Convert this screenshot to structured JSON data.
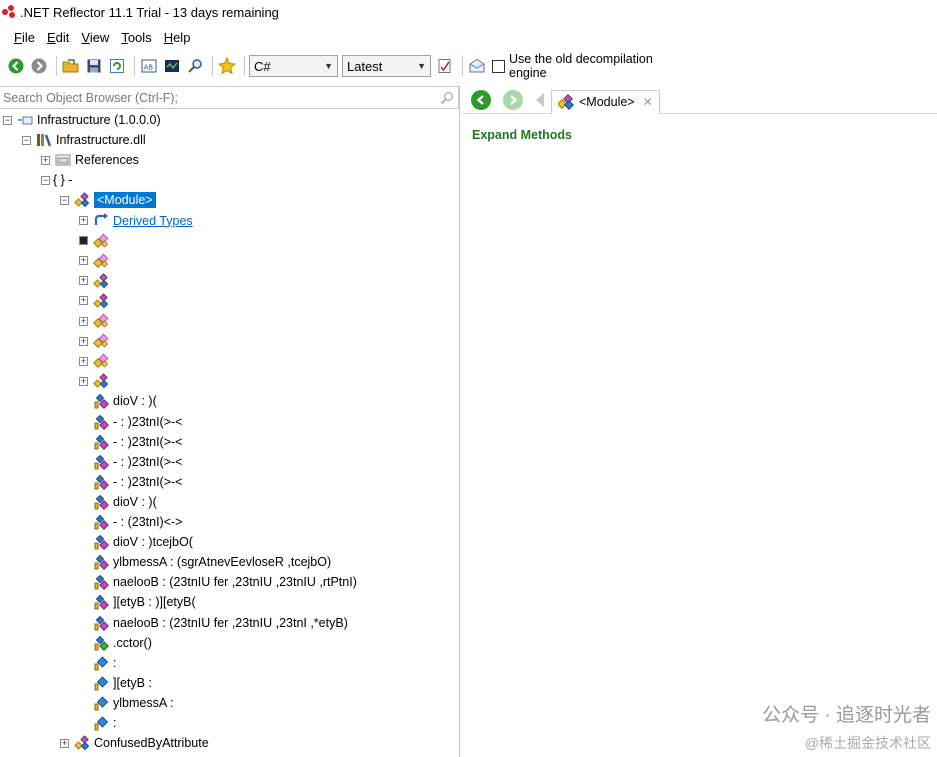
{
  "window": {
    "title": ".NET Reflector 11.1 Trial - 13 days remaining"
  },
  "menu": [
    {
      "label": "File",
      "accel": "F",
      "rest": "ile"
    },
    {
      "label": "Edit",
      "accel": "E",
      "rest": "dit"
    },
    {
      "label": "View",
      "accel": "V",
      "rest": "iew"
    },
    {
      "label": "Tools",
      "accel": "T",
      "rest": "ools"
    },
    {
      "label": "Help",
      "accel": "H",
      "rest": "elp"
    }
  ],
  "toolbar": {
    "language": "C#",
    "framework": "Latest",
    "old_engine_label": "Use the old decompilation engine",
    "old_engine_checked": false
  },
  "search": {
    "placeholder": "Search Object Browser (Ctrl-F);"
  },
  "tree": [
    {
      "label": "Infrastructure (1.0.0.0)",
      "icon": "assembly-icon",
      "level": 0,
      "expander": "minus"
    },
    {
      "label": "Infrastructure.dll",
      "icon": "library-icon",
      "level": 1,
      "expander": "minus"
    },
    {
      "label": "References",
      "icon": "references-icon",
      "level": 2,
      "expander": "plus"
    },
    {
      "label": "{ } -",
      "icon": "",
      "level": 2,
      "expander": "minus"
    },
    {
      "label": "<Module>",
      "icon": "class-icon",
      "level": 3,
      "expander": "minus",
      "selected": true
    },
    {
      "label": "Derived Types",
      "icon": "derived-types-icon",
      "level": 4,
      "expander": "plus",
      "link": true
    },
    {
      "label": "",
      "icon": "nested-class-icon",
      "level": 4,
      "expander": "plus-dark"
    },
    {
      "label": "",
      "icon": "nested-class-icon",
      "level": 4,
      "expander": "plus"
    },
    {
      "label": "",
      "icon": "class-icon",
      "level": 4,
      "expander": "plus"
    },
    {
      "label": "",
      "icon": "class-icon",
      "level": 4,
      "expander": "plus"
    },
    {
      "label": "",
      "icon": "nested-class-icon",
      "level": 4,
      "expander": "plus"
    },
    {
      "label": "",
      "icon": "nested-class-icon",
      "level": 4,
      "expander": "plus"
    },
    {
      "label": "",
      "icon": "nested-class-icon",
      "level": 4,
      "expander": "plus"
    },
    {
      "label": "",
      "icon": "class-icon",
      "level": 4,
      "expander": "plus"
    },
    {
      "label": "dioV : )(",
      "icon": "method-icon",
      "level": 4
    },
    {
      "label": "- : )23tnI(>-<",
      "icon": "method-icon",
      "level": 4
    },
    {
      "label": "- : )23tnI(>-<",
      "icon": "method-icon",
      "level": 4
    },
    {
      "label": "- : )23tnI(>-<",
      "icon": "method-icon",
      "level": 4
    },
    {
      "label": "- : )23tnI(>-<",
      "icon": "method-icon",
      "level": 4
    },
    {
      "label": "dioV : )(",
      "icon": "method-icon",
      "level": 4
    },
    {
      "label": "- : (23tnI)<->",
      "icon": "method-icon",
      "level": 4
    },
    {
      "label": "dioV : )tcejbO(",
      "icon": "method-icon",
      "level": 4
    },
    {
      "label": "ylbmessA : (sgrAtnevEevloseR ,tcejbO)",
      "icon": "method-icon",
      "level": 4
    },
    {
      "label": "naelooB : (23tnIU fer ,23tnIU ,23tnIU ,rtPtnI)",
      "icon": "method-icon",
      "level": 4
    },
    {
      "label": "][etyB : )][etyB(",
      "icon": "method-icon",
      "level": 4
    },
    {
      "label": "naelooB : (23tnIU fer ,23tnIU ,23tnI ,*etyB)",
      "icon": "method-icon",
      "level": 4
    },
    {
      "label": ".cctor()",
      "icon": "static-method-icon",
      "level": 4
    },
    {
      "label": " :",
      "icon": "field-icon",
      "level": 4
    },
    {
      "label": "][etyB :",
      "icon": "field-icon",
      "level": 4
    },
    {
      "label": "ylbmessA :",
      "icon": "field-icon",
      "level": 4
    },
    {
      "label": " :",
      "icon": "field-icon",
      "level": 4
    },
    {
      "label": "ConfusedByAttribute",
      "icon": "class-icon",
      "level": 3,
      "expander": "plus"
    }
  ],
  "right": {
    "tab_label": "<Module>",
    "expand_methods": "Expand Methods"
  },
  "watermark": {
    "line1": "公众号 · 追逐时光者",
    "line2": "@稀土掘金技术社区"
  }
}
